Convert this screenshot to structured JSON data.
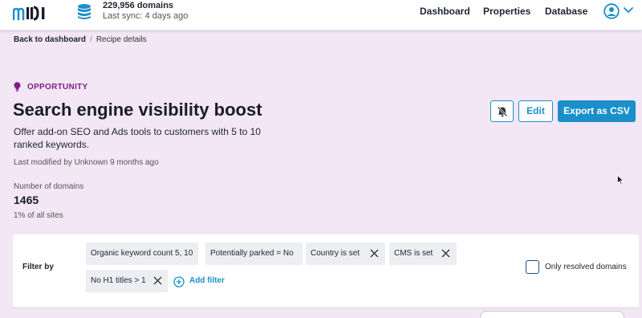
{
  "nav": {
    "logo_text": "mDI",
    "domain_count": "229,956 domains",
    "last_sync": "Last sync: 4 days ago",
    "links": [
      "Dashboard",
      "Properties",
      "Database"
    ],
    "user_icon": "user-circle-icon",
    "menu_icon": "chevron-down-icon"
  },
  "breadcrumb": {
    "back": "Back to dashboard",
    "separator": "/",
    "current": "Recipe details"
  },
  "header": {
    "kind": "OPPORTUNITY",
    "kind_icon": "lightbulb-icon",
    "title": "Search engine visibility boost",
    "description": "Offer add-on SEO and Ads tools to customers with 5 to 10 ranked keywords.",
    "modified": "Last modified by Unknown 9 months ago"
  },
  "actions": {
    "mute_icon": "bell-off-icon",
    "edit_label": "Edit",
    "export_label": "Export as CSV"
  },
  "stats": {
    "label": "Number of domains",
    "value": "1465",
    "sub": "1% of all sites"
  },
  "filters": {
    "label": "Filter by",
    "chips": [
      {
        "text": "Organic keyword count 5, 10",
        "removable": false
      },
      {
        "text": "Potentially parked = No",
        "removable": false
      },
      {
        "text": "Country is set",
        "removable": true
      },
      {
        "text": "CMS is set",
        "removable": true
      },
      {
        "text": "No H1 titles > 1",
        "removable": true
      }
    ],
    "add_filter": "Add filter",
    "only_resolved": "Only resolved domains",
    "only_resolved_checked": false
  },
  "colors": {
    "accent": "#1b8fc9",
    "page_bg": "#f3e6f5",
    "opportunity": "#7b1f87"
  }
}
